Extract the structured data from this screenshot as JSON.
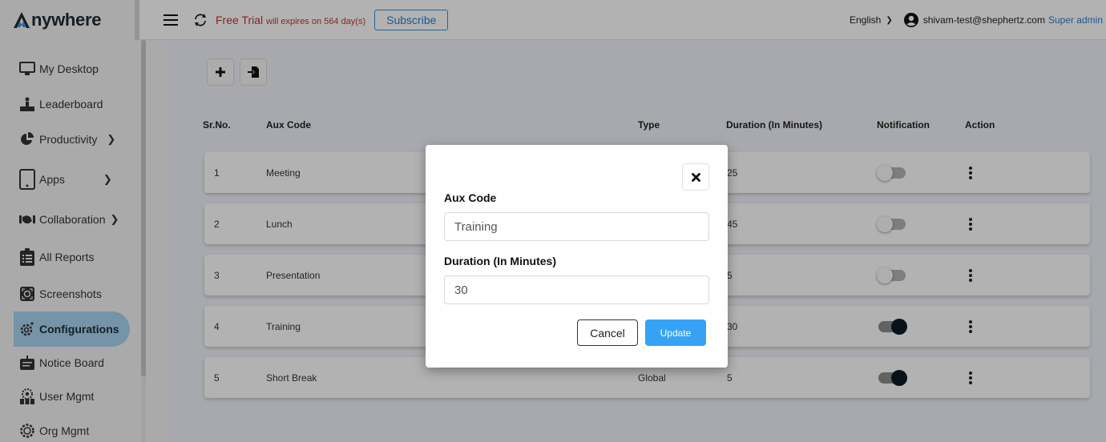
{
  "header": {
    "logo_text": "nywhere",
    "trial_label": "Free Trial",
    "trial_note": "will expires on 564 day(s)",
    "subscribe_label": "Subscribe",
    "language": "English",
    "user_email": "shivam-test@shephertz.com",
    "user_role": "Super admin"
  },
  "sidebar": {
    "items": [
      {
        "label": "My Desktop",
        "icon": "desktop-icon",
        "has_arrow": false
      },
      {
        "label": "Leaderboard",
        "icon": "leaderboard-icon",
        "has_arrow": false
      },
      {
        "label": "Productivity",
        "icon": "pie-chart-icon",
        "has_arrow": true
      },
      {
        "label": "Apps",
        "icon": "tablet-icon",
        "has_arrow": true
      },
      {
        "label": "Collaboration",
        "icon": "handshake-icon",
        "has_arrow": true
      },
      {
        "label": "All Reports",
        "icon": "clipboard-list-icon",
        "has_arrow": false
      },
      {
        "label": "Screenshots",
        "icon": "screenshot-icon",
        "has_arrow": false
      },
      {
        "label": "Configurations",
        "icon": "gear-icon",
        "has_arrow": false,
        "active": true
      },
      {
        "label": "Notice Board",
        "icon": "notice-board-icon",
        "has_arrow": false
      },
      {
        "label": "User Mgmt",
        "icon": "user-group-icon",
        "has_arrow": false
      },
      {
        "label": "Org Mgmt",
        "icon": "org-gear-icon",
        "has_arrow": false
      }
    ],
    "arrow_glyph": ">"
  },
  "toolbar": {
    "add_icon": "plus-icon",
    "import_icon": "file-import-icon"
  },
  "table": {
    "headers": {
      "srno": "Sr.No.",
      "aux_code": "Aux Code",
      "type": "Type",
      "duration": "Duration (In Minutes)",
      "notification": "Notification",
      "action": "Action"
    },
    "rows": [
      {
        "srno": "1",
        "aux_code": "Meeting",
        "type": "",
        "duration": "25",
        "notification": false
      },
      {
        "srno": "2",
        "aux_code": "Lunch",
        "type": "",
        "duration": "45",
        "notification": false
      },
      {
        "srno": "3",
        "aux_code": "Presentation",
        "type": "",
        "duration": "5",
        "notification": false
      },
      {
        "srno": "4",
        "aux_code": "Training",
        "type": "",
        "duration": "30",
        "notification": true
      },
      {
        "srno": "5",
        "aux_code": "Short Break",
        "type": "Global",
        "duration": "5",
        "notification": true
      }
    ]
  },
  "modal": {
    "aux_code_label": "Aux Code",
    "aux_code_value": "Training",
    "duration_label": "Duration (In Minutes)",
    "duration_value": "30",
    "cancel_label": "Cancel",
    "update_label": "Update",
    "close_icon": "close-icon"
  },
  "colors": {
    "accent": "#36a2f5",
    "trial_red": "#c0392b",
    "link_blue": "#2a7fcf",
    "active_nav": "#a9d4f0"
  }
}
